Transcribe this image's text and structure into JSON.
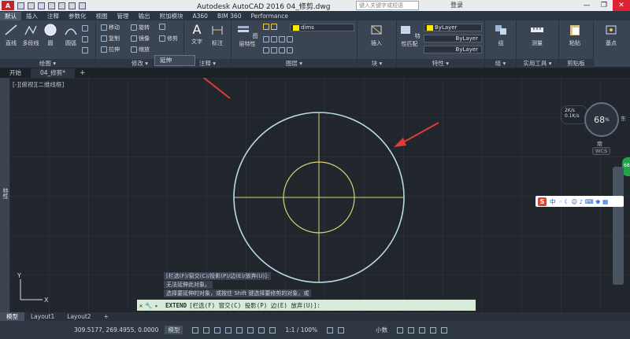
{
  "titlebar": {
    "logo": "A",
    "title": "Autodesk AutoCAD 2016    04_修剪.dwg",
    "search_placeholder": "键入关键字或短语",
    "login": "登录",
    "min": "—",
    "max": "❐",
    "close": "✕"
  },
  "ribbon_tabs": [
    "默认",
    "插入",
    "注释",
    "参数化",
    "视图",
    "管理",
    "输出",
    "附加模块",
    "A360",
    "BIM 360",
    "Performance"
  ],
  "ribbon": {
    "draw": {
      "title": "绘图 ▾",
      "line": "直线",
      "polyline": "多段线",
      "circle": "圆",
      "arc": "圆弧"
    },
    "modify": {
      "title": "修改 ▾",
      "move": "移动",
      "rotate": "旋转",
      "copy": "复制",
      "mirror": "镜像",
      "stretch": "拉伸",
      "scale": "缩放",
      "trim": "修剪"
    },
    "annotation": {
      "title": "注释 ▾",
      "text": "文字",
      "dimension": "标注"
    },
    "layers": {
      "title": "图层 ▾",
      "layer_props": "图层特性",
      "layer_name": "dims"
    },
    "block": {
      "title": "块 ▾",
      "insert": "插入"
    },
    "properties": {
      "title": "特性 ▾",
      "match": "特性匹配",
      "color": "ByLayer",
      "linetype": "ByLayer",
      "lineweight": "ByLayer"
    },
    "groups": {
      "title": "组 ▾",
      "group": "组"
    },
    "utilities": {
      "title": "实用工具 ▾",
      "measure": "测量"
    },
    "clipboard": {
      "title": "剪贴板",
      "paste": "粘贴"
    },
    "base": {
      "title": "",
      "base": "基点"
    }
  },
  "extend_menu": "延伸",
  "doc_tabs": {
    "start": "开始",
    "active": "04_修剪*",
    "plus": "+"
  },
  "viewport_label": "[-][俯视][二维线框]",
  "left_strip": "特性",
  "command_history": [
    "[栏选(F)/窗交(C)/投影(P)/边(E)/放弃(U)]:",
    "无法延伸此对象。",
    "选择要延伸的对象，或按住 Shift 键选择要修剪的对象，或"
  ],
  "command_line": {
    "close": "✕",
    "wrench": "🔧",
    "prompt_icon": "▸",
    "command": "EXTEND",
    "text": "[栏选(F) 窗交(C) 投影(P) 边(E) 放弃(U)]:"
  },
  "layout_tabs": [
    "模型",
    "Layout1",
    "Layout2",
    "+"
  ],
  "status": {
    "coords": "309.5177, 269.4955, 0.0000",
    "model": "模型",
    "scale": "1:1 / 100%",
    "units": "小数"
  },
  "navcube": {
    "percent": "68",
    "unit": "%",
    "east": "东",
    "south": "南",
    "wcs": "WCS"
  },
  "netspeed": {
    "up": "2K/s",
    "down": "0.1K/s"
  },
  "green_badge": "68",
  "ime": {
    "logo": "S",
    "mode": "中",
    "icons": "◦ ☾ ☺ ♪ ⌨ ♚ ▦"
  },
  "colors": {
    "circle_outer": "#b8dce8",
    "circle_inner": "#d8d27a",
    "crosshair": "#d8d27a",
    "arrow": "#e03a3a",
    "accent_yellow": "#ffeb00"
  }
}
